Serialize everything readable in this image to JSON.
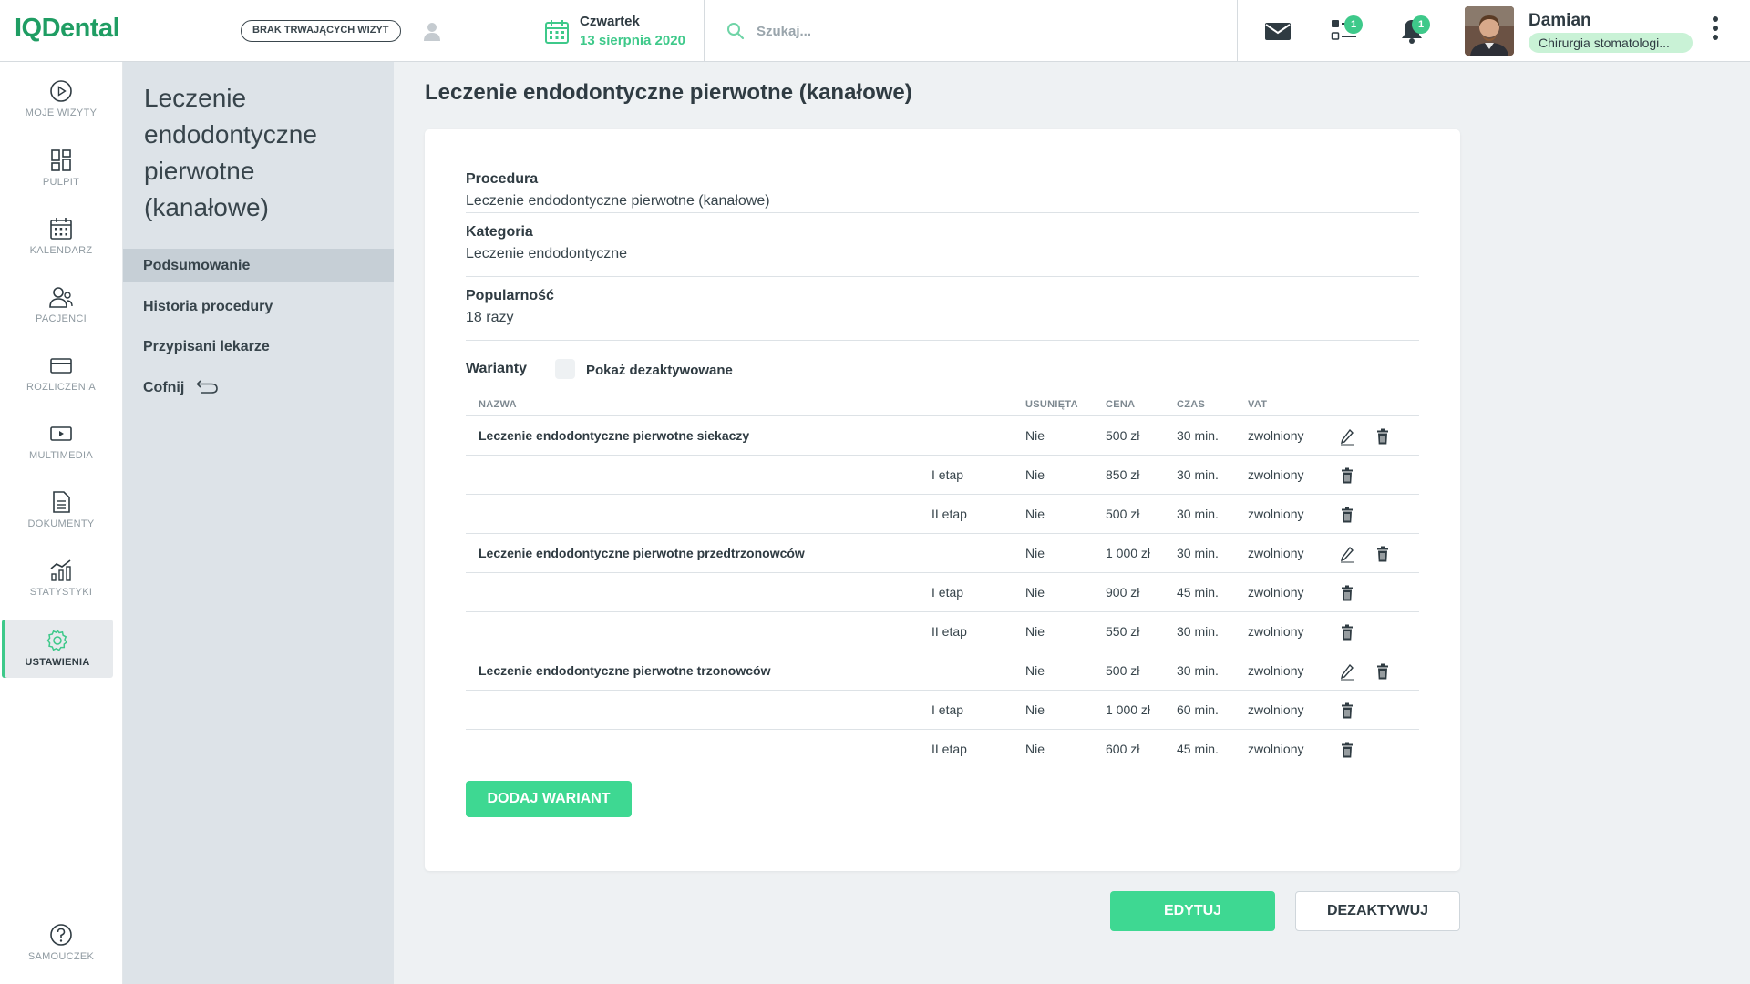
{
  "app": {
    "logo": "IQDental"
  },
  "topbar": {
    "visit_status": "BRAK TRWAJĄCYCH WIZYT",
    "day": "Czwartek",
    "date": "13 sierpnia 2020",
    "search_placeholder": "Szukaj...",
    "tasks_badge": "1",
    "notifications_badge": "1",
    "user_name": "Damian",
    "user_role": "Chirurgia stomatologi..."
  },
  "colors": {
    "brand": "#1f9d63",
    "accent": "#3ed892",
    "badge": "#3ec98a"
  },
  "nav": {
    "items": [
      {
        "label": "MOJE WIZYTY",
        "icon": "play-circle-icon"
      },
      {
        "label": "PULPIT",
        "icon": "dashboard-icon"
      },
      {
        "label": "KALENDARZ",
        "icon": "calendar-icon"
      },
      {
        "label": "PACJENCI",
        "icon": "patients-icon"
      },
      {
        "label": "ROZLICZENIA",
        "icon": "card-icon"
      },
      {
        "label": "MULTIMEDIA",
        "icon": "media-icon"
      },
      {
        "label": "DOKUMENTY",
        "icon": "document-icon"
      },
      {
        "label": "STATYSTYKI",
        "icon": "stats-icon"
      },
      {
        "label": "USTAWIENIA",
        "icon": "gear-icon"
      }
    ],
    "help": "SAMOUCZEK"
  },
  "subnav": {
    "title": "Leczenie endodontyczne pierwotne (kanałowe)",
    "items": [
      "Podsumowanie",
      "Historia procedury",
      "Przypisani lekarze",
      "Cofnij"
    ]
  },
  "main": {
    "title": "Leczenie endodontyczne pierwotne (kanałowe)",
    "fields": [
      {
        "label": "Procedura",
        "value": "Leczenie endodontyczne pierwotne (kanałowe)"
      },
      {
        "label": "Kategoria",
        "value": "Leczenie endodontyczne"
      },
      {
        "label": "Popularność",
        "value": "18 razy"
      }
    ],
    "variants_title": "Warianty",
    "show_deactivated": "Pokaż dezaktywowane",
    "columns": {
      "name": "NAZWA",
      "deleted": "USUNIĘTA",
      "price": "CENA",
      "time": "CZAS",
      "vat": "VAT"
    },
    "rows": [
      {
        "name": "Leczenie endodontyczne pierwotne siekaczy",
        "stage": "",
        "deleted": "Nie",
        "price": "500 zł",
        "time": "30 min.",
        "vat": "zwolniony"
      },
      {
        "name": "",
        "stage": "I etap",
        "deleted": "Nie",
        "price": "850 zł",
        "time": "30 min.",
        "vat": "zwolniony"
      },
      {
        "name": "",
        "stage": "II etap",
        "deleted": "Nie",
        "price": "500 zł",
        "time": "30 min.",
        "vat": "zwolniony"
      },
      {
        "name": "Leczenie endodontyczne pierwotne przedtrzonowców",
        "stage": "",
        "deleted": "Nie",
        "price": "1 000 zł",
        "time": "30 min.",
        "vat": "zwolniony"
      },
      {
        "name": "",
        "stage": "I etap",
        "deleted": "Nie",
        "price": "900 zł",
        "time": "45 min.",
        "vat": "zwolniony"
      },
      {
        "name": "",
        "stage": "II etap",
        "deleted": "Nie",
        "price": "550 zł",
        "time": "30 min.",
        "vat": "zwolniony"
      },
      {
        "name": "Leczenie endodontyczne pierwotne trzonowców",
        "stage": "",
        "deleted": "Nie",
        "price": "500 zł",
        "time": "30 min.",
        "vat": "zwolniony"
      },
      {
        "name": "",
        "stage": "I etap",
        "deleted": "Nie",
        "price": "1 000 zł",
        "time": "60 min.",
        "vat": "zwolniony"
      },
      {
        "name": "",
        "stage": "II etap",
        "deleted": "Nie",
        "price": "600 zł",
        "time": "45 min.",
        "vat": "zwolniony"
      }
    ],
    "add_variant": "DODAJ WARIANT",
    "edit": "EDYTUJ",
    "deactivate": "DEZAKTYWUJ"
  }
}
